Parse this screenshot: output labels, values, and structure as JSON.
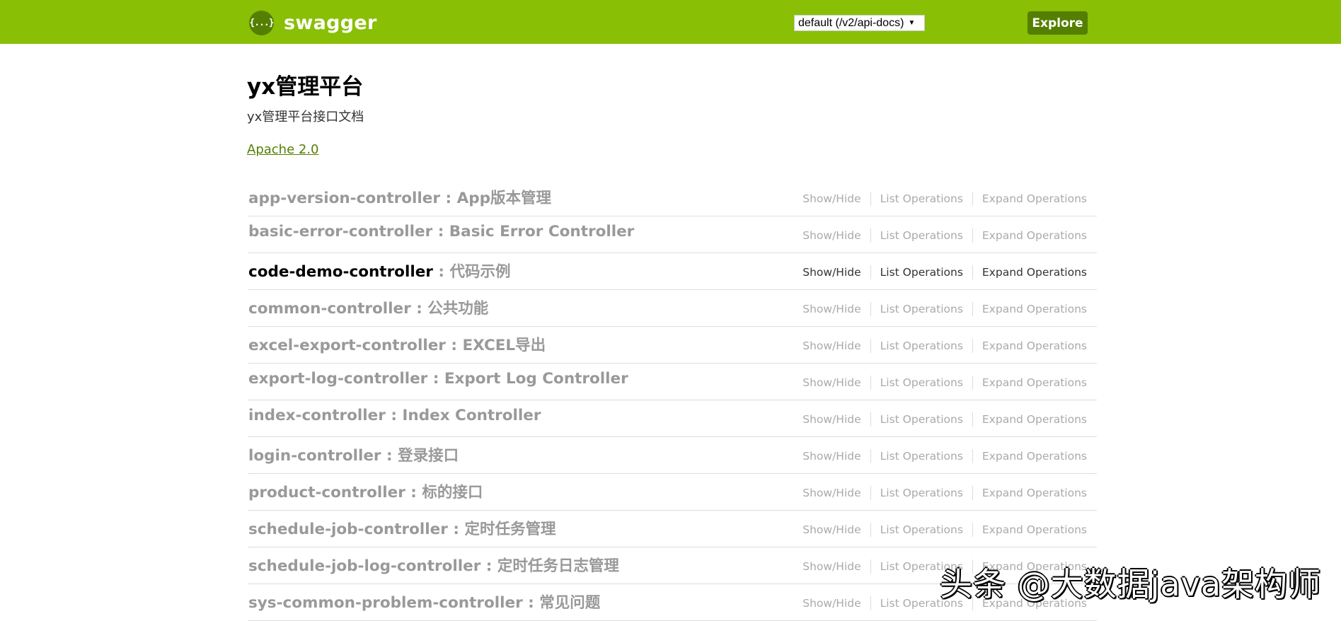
{
  "header": {
    "logo_icon": "{...}",
    "logo_text": "swagger",
    "api_select": {
      "selected": "default (/v2/api-docs)",
      "arrow": "▼"
    },
    "explore_label": "Explore",
    "colors": {
      "background": "#89bf04",
      "button": "#547f00"
    }
  },
  "info": {
    "title": "yx管理平台",
    "description": "yx管理平台接口文档",
    "license": "Apache 2.0"
  },
  "resources": [
    {
      "name": "app-version-controller",
      "separator": " : ",
      "description": "App版本管理",
      "hovered": false
    },
    {
      "name": "basic-error-controller",
      "separator": " : ",
      "description": "Basic Error Controller",
      "hovered": false
    },
    {
      "name": "code-demo-controller",
      "separator": " : ",
      "description": "代码示例",
      "hovered": true
    },
    {
      "name": "common-controller",
      "separator": " : ",
      "description": "公共功能",
      "hovered": false
    },
    {
      "name": "excel-export-controller",
      "separator": " : ",
      "description": "EXCEL导出",
      "hovered": false
    },
    {
      "name": "export-log-controller",
      "separator": " : ",
      "description": "Export Log Controller",
      "hovered": false
    },
    {
      "name": "index-controller",
      "separator": " : ",
      "description": "Index Controller",
      "hovered": false
    },
    {
      "name": "login-controller",
      "separator": " : ",
      "description": "登录接口",
      "hovered": false
    },
    {
      "name": "product-controller",
      "separator": " : ",
      "description": "标的接口",
      "hovered": false
    },
    {
      "name": "schedule-job-controller",
      "separator": " : ",
      "description": "定时任务管理",
      "hovered": false
    },
    {
      "name": "schedule-job-log-controller",
      "separator": " : ",
      "description": "定时任务日志管理",
      "hovered": false
    },
    {
      "name": "sys-common-problem-controller",
      "separator": " : ",
      "description": "常见问题",
      "hovered": false
    }
  ],
  "operations": {
    "show_hide": "Show/Hide",
    "list": "List Operations",
    "expand": "Expand Operations"
  },
  "watermark": "头条 @大数据java架构师"
}
